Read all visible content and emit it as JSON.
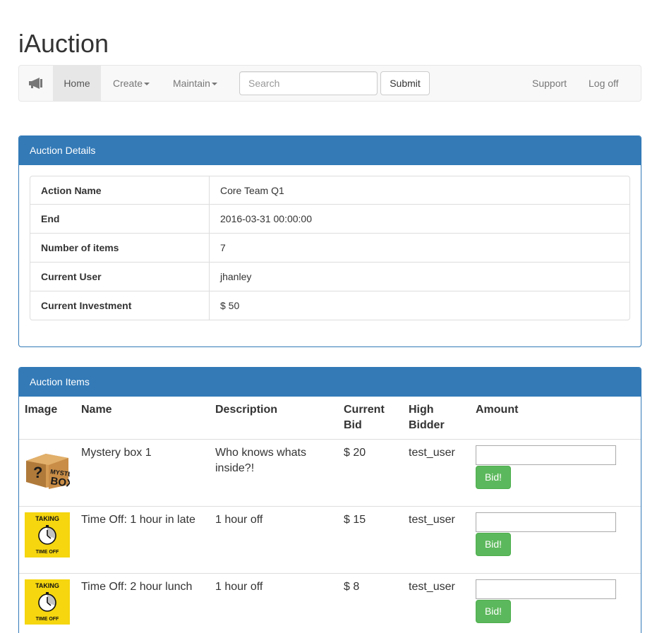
{
  "app": {
    "title": "iAuction"
  },
  "nav": {
    "brand_icon": "megaphone-icon",
    "home": "Home",
    "create": "Create",
    "maintain": "Maintain",
    "search_placeholder": "Search",
    "submit": "Submit",
    "support": "Support",
    "logoff": "Log off"
  },
  "details": {
    "heading": "Auction Details",
    "rows": [
      {
        "label": "Action Name",
        "value": "Core Team Q1"
      },
      {
        "label": "End",
        "value": "2016-03-31 00:00:00"
      },
      {
        "label": "Number of items",
        "value": "7"
      },
      {
        "label": "Current User",
        "value": "jhanley"
      },
      {
        "label": "Current Investment",
        "value": "$ 50"
      }
    ]
  },
  "items": {
    "heading": "Auction Items",
    "columns": [
      "Image",
      "Name",
      "Description",
      "Current Bid",
      "High Bidder",
      "Amount"
    ],
    "bid_label": "Bid!",
    "rows": [
      {
        "image": "mystery-box",
        "image_text_top": "MYSTERY",
        "image_text_bottom": "BOX",
        "name": "Mystery box 1",
        "description": "Who knows whats inside?!",
        "current_bid": "$ 20",
        "high_bidder": "test_user",
        "amount": ""
      },
      {
        "image": "taking-time-off",
        "image_text_top": "TAKING",
        "image_text_bottom": "TIME OFF",
        "name": "Time Off: 1 hour in late",
        "description": "1 hour off",
        "current_bid": "$ 15",
        "high_bidder": "test_user",
        "amount": ""
      },
      {
        "image": "taking-time-off",
        "image_text_top": "TAKING",
        "image_text_bottom": "TIME OFF",
        "name": "Time Off: 2 hour lunch",
        "description": "1 hour off",
        "current_bid": "$ 8",
        "high_bidder": "test_user",
        "amount": ""
      }
    ]
  },
  "colors": {
    "primary": "#337ab7",
    "success": "#5cb85c",
    "navbar_bg": "#f8f8f8",
    "time_off_yellow": "#f5d60f"
  }
}
